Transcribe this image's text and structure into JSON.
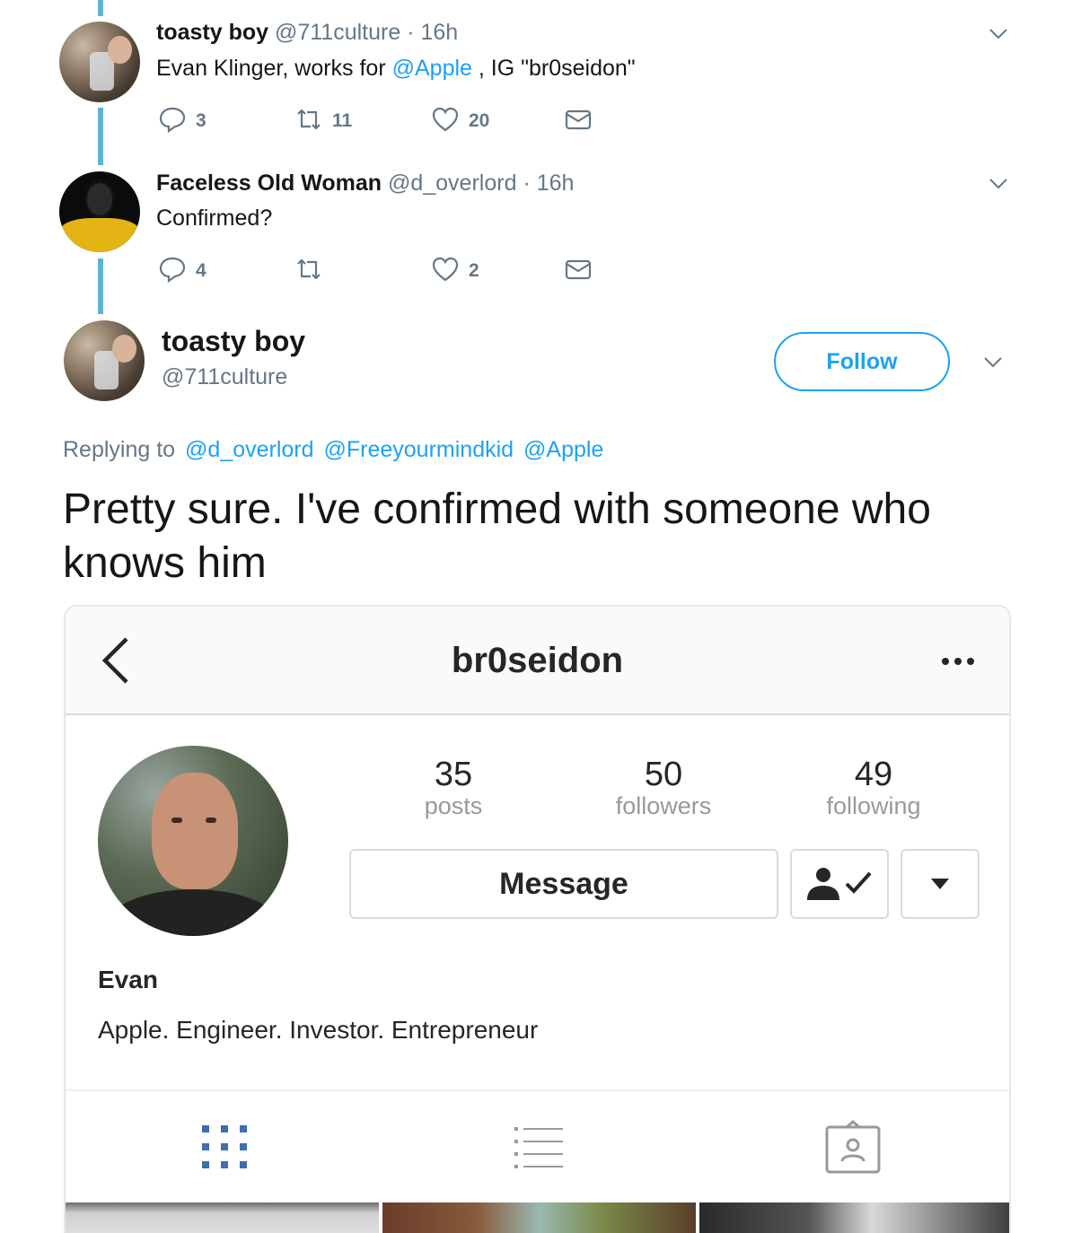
{
  "tweets": [
    {
      "name": "toasty boy",
      "handle": "@711culture",
      "time": "16h",
      "text_before": "Evan Klinger, works for ",
      "text_link": "@Apple",
      "text_after": " , IG \"br0seidon\"",
      "replies": "3",
      "retweets": "11",
      "likes": "20"
    },
    {
      "name": "Faceless Old Woman",
      "handle": "@d_overlord",
      "time": "16h",
      "text": "Confirmed?",
      "replies": "4",
      "retweets": "",
      "likes": "2"
    }
  ],
  "main_tweet": {
    "name": "toasty boy",
    "handle": "@711culture",
    "follow_label": "Follow",
    "replying_label": "Replying to",
    "replying_to": [
      "@d_overlord",
      "@Freeyourmindkid",
      "@Apple"
    ],
    "text": "Pretty sure. I've confirmed with someone who knows him"
  },
  "instagram": {
    "username": "br0seidon",
    "stats": [
      {
        "num": "35",
        "label": "posts"
      },
      {
        "num": "50",
        "label": "followers"
      },
      {
        "num": "49",
        "label": "following"
      }
    ],
    "message_label": "Message",
    "name": "Evan",
    "bio": "Apple. Engineer. Investor. Entrepreneur"
  },
  "colors": {
    "accent": "#1da1f2",
    "thread_line": "#5fb2d6",
    "muted": "#657786"
  }
}
